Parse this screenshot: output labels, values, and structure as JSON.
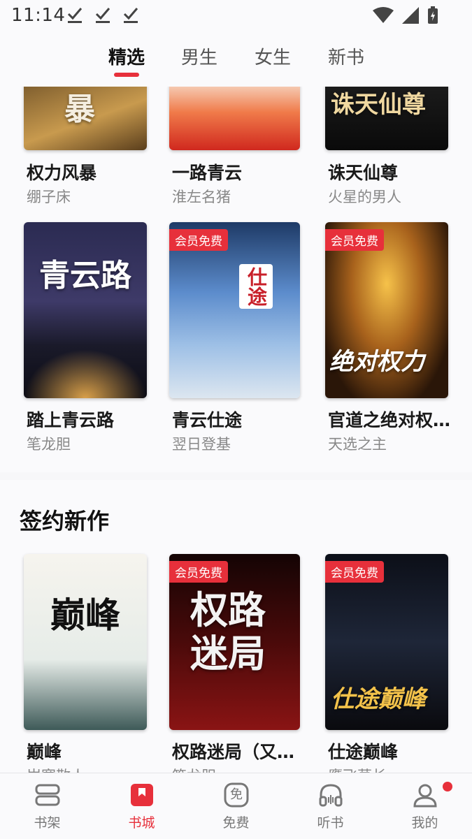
{
  "status": {
    "time": "11:14"
  },
  "tabs": [
    {
      "label": "精选",
      "active": true
    },
    {
      "label": "男生",
      "active": false
    },
    {
      "label": "女生",
      "active": false
    },
    {
      "label": "新书",
      "active": false
    }
  ],
  "featured": {
    "books": [
      {
        "title": "权力风暴",
        "author": "绷子床",
        "cover_text": "暴"
      },
      {
        "title": "一路青云",
        "author": "淮左名猪",
        "cover_text": ""
      },
      {
        "title": "诛天仙尊",
        "author": "火星的男人",
        "cover_text": "诛天仙尊"
      },
      {
        "title": "踏上青云路",
        "author": "笔龙胆",
        "cover_text": "青云路",
        "badge": ""
      },
      {
        "title": "青云仕途",
        "author": "翌日登基",
        "cover_text": "仕途",
        "badge": "会员免费"
      },
      {
        "title": "官道之绝对权…",
        "author": "天选之主",
        "cover_text": "绝对权力",
        "badge": "会员免费"
      }
    ]
  },
  "signed": {
    "heading": "签约新作",
    "books": [
      {
        "title": "巅峰",
        "author": "岁寒散人",
        "cover_text": "巅峰",
        "badge": ""
      },
      {
        "title": "权路迷局（又…",
        "author": "笔龙胆",
        "cover_text": "权路迷局",
        "badge": "会员免费"
      },
      {
        "title": "仕途巅峰",
        "author": "鹰飞草长",
        "cover_text": "仕途巅峰",
        "badge": "会员免费"
      }
    ]
  },
  "bottom_nav": [
    {
      "label": "书架",
      "icon": "bookshelf-icon",
      "active": false
    },
    {
      "label": "书城",
      "icon": "bookstore-icon",
      "active": true
    },
    {
      "label": "免费",
      "icon": "free-icon",
      "active": false,
      "icon_text": "免"
    },
    {
      "label": "听书",
      "icon": "headphones-icon",
      "active": false
    },
    {
      "label": "我的",
      "icon": "profile-icon",
      "active": false
    }
  ],
  "colors": {
    "accent": "#e7303b"
  }
}
